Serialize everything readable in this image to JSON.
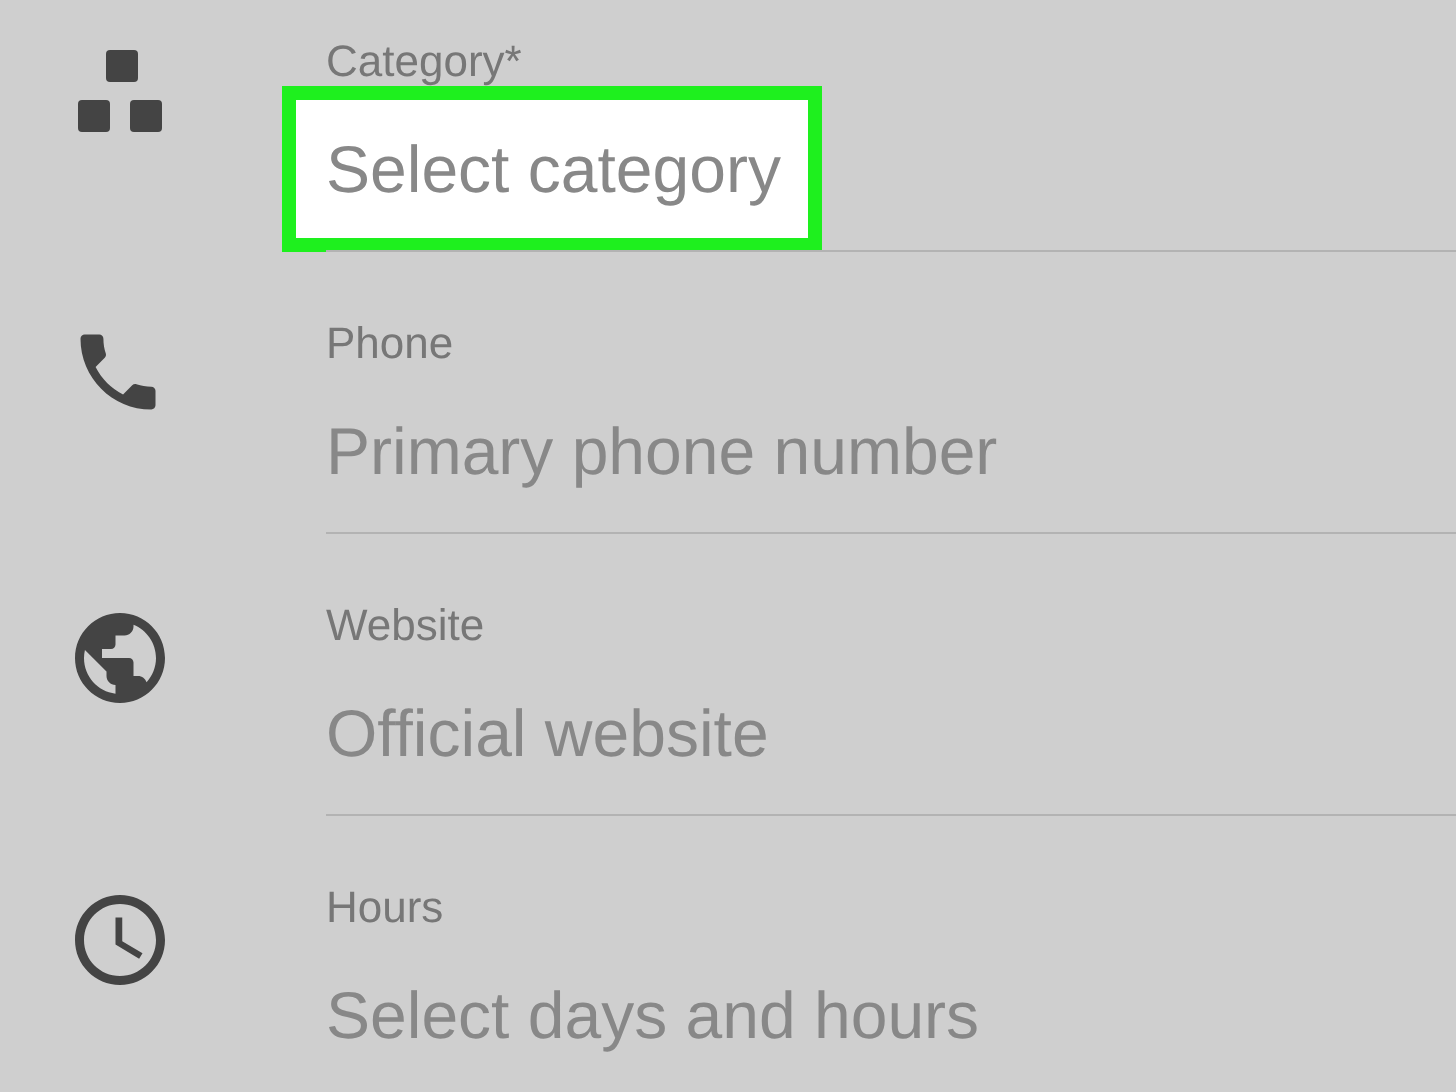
{
  "fields": [
    {
      "label": "Category*",
      "placeholder": "Select category",
      "highlighted": true
    },
    {
      "label": "Phone",
      "placeholder": "Primary phone number",
      "highlighted": false
    },
    {
      "label": "Website",
      "placeholder": "Official website",
      "highlighted": false
    },
    {
      "label": "Hours",
      "placeholder": "Select days and hours",
      "highlighted": false
    }
  ]
}
